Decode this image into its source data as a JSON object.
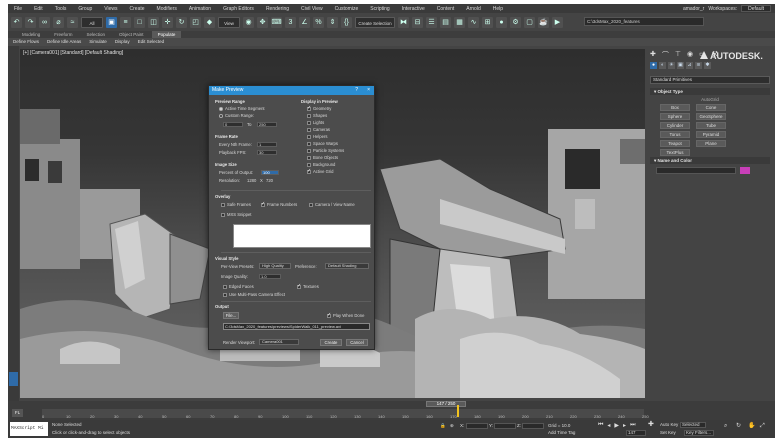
{
  "menu": [
    "File",
    "Edit",
    "Tools",
    "Group",
    "Views",
    "Create",
    "Modifiers",
    "Animation",
    "Graph Editors",
    "Rendering",
    "Civil View",
    "Customize",
    "Scripting",
    "Interactive",
    "Content",
    "Arnold",
    "Help"
  ],
  "user": "amador_r",
  "workspaces_label": "Workspaces:",
  "workspace_value": "Default",
  "toolbar": {
    "selection_filter": "All",
    "view_dropdown": "View",
    "selection_set": "Create Selection Se",
    "project_path": "C:\\3dsMax_2020_features"
  },
  "ribbon_tabs": [
    "Modeling",
    "Freeform",
    "Selection",
    "Object Paint",
    "Populate"
  ],
  "ribbon_active": "Populate",
  "ribbon_sub": [
    "Define Flows",
    "Define Idle Areas",
    "Simulate",
    "Display",
    "Edit Selected"
  ],
  "viewport_label": "[+] [Camera001] [Standard] [Default Shading]",
  "brand": "AUTODESK.",
  "cmdpanel": {
    "dropdown": "Standard Primitives",
    "object_type_header": "Object Type",
    "autogrid": "AutoGrid",
    "buttons": [
      "Box",
      "Cone",
      "Sphere",
      "GeoSphere",
      "Cylinder",
      "Tube",
      "Torus",
      "Pyramid",
      "Teapot",
      "Plane",
      "TextPlus"
    ],
    "name_color_header": "Name and Color"
  },
  "dialog": {
    "title": "Make Preview",
    "help": "?",
    "close": "×",
    "preview_range": "Preview Range",
    "active_time_segment": "Active Time Segment",
    "custom_range": "Custom Range:",
    "range_start": "0",
    "range_to": "To",
    "range_end": "250",
    "frame_rate": "Frame Rate",
    "every_nth_frame": "Every Nth Frame:",
    "every_nth_value": "1",
    "playback_fps": "Playback FPS:",
    "playback_fps_value": "30",
    "image_size": "Image Size",
    "percent_output": "Percent of Output:",
    "percent_output_value": "100",
    "resolution": "Resolution:",
    "res_w": "1280",
    "res_x": "X",
    "res_h": "720",
    "display_in_preview": "Display in Preview",
    "display_items": [
      {
        "label": "Geometry",
        "on": true
      },
      {
        "label": "Shapes",
        "on": false
      },
      {
        "label": "Lights",
        "on": false
      },
      {
        "label": "Cameras",
        "on": false
      },
      {
        "label": "Helpers",
        "on": false
      },
      {
        "label": "Space Warps",
        "on": false
      },
      {
        "label": "Particle Systems",
        "on": false
      },
      {
        "label": "Bone Objects",
        "on": false
      },
      {
        "label": "Background",
        "on": false
      },
      {
        "label": "Active Grid",
        "on": true
      }
    ],
    "overlay": "Overlay",
    "safe_frames": "Safe Frames",
    "frame_numbers": "Frame Numbers",
    "camera_view_name": "Camera / View Name",
    "mxs_snippet": "MXS Snippet",
    "visual_style": "Visual Style",
    "per_view_presets": "Per-View Presets:",
    "per_view_presets_value": "High Quality",
    "preference": "Preference:",
    "preference_value": "Default Shading",
    "image_quality": "Image Quality:",
    "image_quality_value": "1.0",
    "edged_faces": "Edged Faces",
    "textures": "Textures",
    "multipass": "Use Multi-Pass Camera Effect",
    "output": "Output",
    "file_btn": "File...",
    "play_when_done": "Play When Done",
    "output_path": "C:\\3dsMax_2020_features\\previews\\SpiderWalk_011_preview.avi",
    "render_viewport": "Render Viewport:",
    "render_viewport_value": "Camera001",
    "create": "Create",
    "cancel": "Cancel"
  },
  "timeline": {
    "slider_label": "147 / 250",
    "ticks": [
      "0",
      "10",
      "20",
      "30",
      "40",
      "50",
      "60",
      "70",
      "80",
      "90",
      "100",
      "110",
      "120",
      "130",
      "140",
      "150",
      "160",
      "170",
      "180",
      "190",
      "200",
      "210",
      "220",
      "230",
      "240",
      "250"
    ]
  },
  "status": {
    "maxscript": "MAXScript Mi",
    "line1": "None Selected",
    "line2": "Click or click-and-drag to select objects",
    "x_label": "X:",
    "y_label": "Y:",
    "z_label": "Z:",
    "grid": "Grid = 10.0",
    "add_time_tag": "Add Time Tag",
    "auto_key": "Auto Key",
    "selected": "Selected",
    "set_key": "Set Key",
    "key_filters": "Key Filters...",
    "frame_value": "147"
  }
}
